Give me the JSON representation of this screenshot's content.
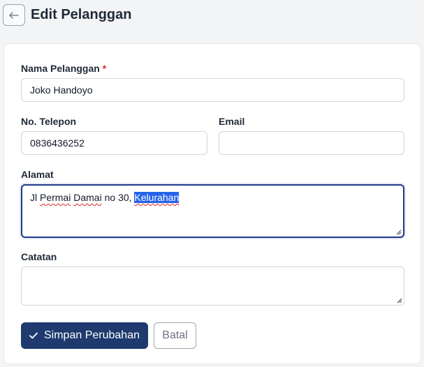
{
  "header": {
    "back_icon": "arrow-left-icon",
    "title": "Edit Pelanggan"
  },
  "form": {
    "name": {
      "label": "Nama Pelanggan",
      "required_mark": "*",
      "value": "Joko Handoyo"
    },
    "phone": {
      "label": "No. Telepon",
      "value": "0836436252"
    },
    "email": {
      "label": "Email",
      "value": ""
    },
    "address": {
      "label": "Alamat",
      "value_plain": "Jl ",
      "value_misspelled_1": "Permai",
      "value_space": " ",
      "value_misspelled_2": "Damai",
      "value_mid": " no 30, ",
      "value_selected": "Kelurahan"
    },
    "notes": {
      "label": "Catatan",
      "value": ""
    }
  },
  "actions": {
    "save_icon": "check-icon",
    "save_label": "Simpan Perubahan",
    "cancel_label": "Batal"
  },
  "colors": {
    "primary": "#1e3a6e",
    "required": "#dc2626",
    "selection": "#2563eb"
  }
}
